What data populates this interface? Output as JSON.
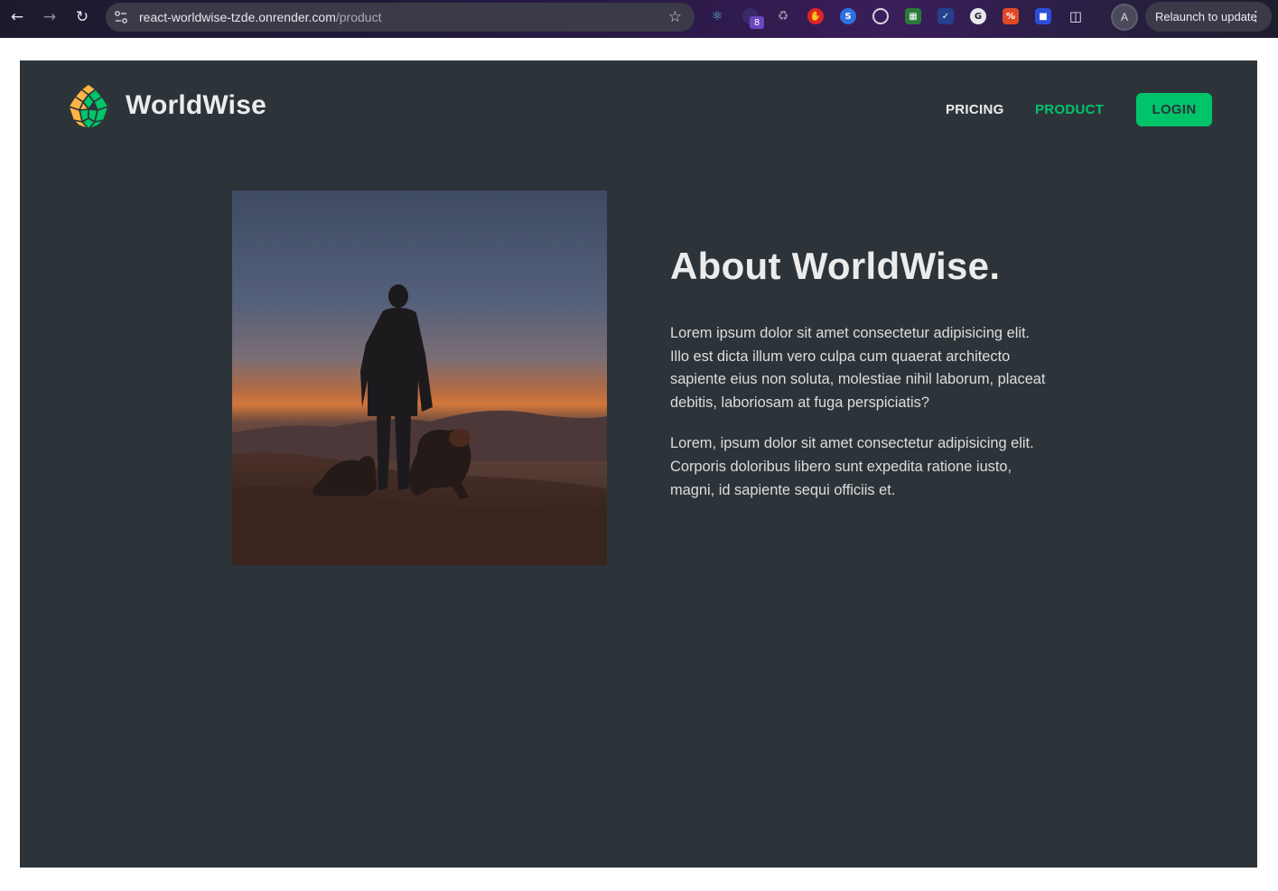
{
  "browser": {
    "url_host": "react-worldwise-tzde.onrender.com",
    "url_path": "/product",
    "extension_badge": "8",
    "profile_initial": "A",
    "relaunch_label": "Relaunch to update"
  },
  "header": {
    "brand": "WorldWise",
    "nav": [
      {
        "label": "PRICING",
        "active": false
      },
      {
        "label": "PRODUCT",
        "active": true
      }
    ],
    "login_label": "LOGIN"
  },
  "main": {
    "image_alt": "person with dog standing on a hill at sunset",
    "title": "About WorldWise.",
    "paragraphs": [
      "Lorem ipsum dolor sit amet consectetur adipisicing elit. Illo est dicta illum vero culpa cum quaerat architecto sapiente eius non soluta, molestiae nihil laborum, placeat debitis, laboriosam at fuga perspiciatis?",
      "Lorem, ipsum dolor sit amet consectetur adipisicing elit. Corporis doloribus libero sunt expedita ratione iusto, magni, id sapiente sequi officiis et."
    ]
  },
  "colors": {
    "accent": "#00c46a",
    "background": "#2d3439",
    "text": "#ececec"
  }
}
